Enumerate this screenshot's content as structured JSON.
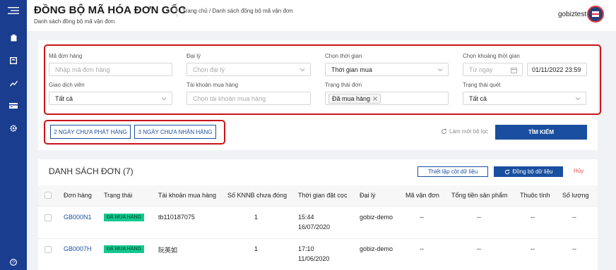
{
  "header": {
    "title": "ĐỒNG BỘ MÃ HÓA ĐƠN GỐC",
    "subtitle": "Danh sách đồng bộ mã vận đơn",
    "breadcrumb_home": "Trang chủ",
    "breadcrumb_sep": " / ",
    "breadcrumb_current": "Danh sách đồng bộ mã vận đơn",
    "username": "gobiztest"
  },
  "sidebar": {
    "icons": [
      "menu-icon",
      "clipboard-icon",
      "box-icon",
      "chart-icon",
      "card-icon",
      "gear-icon",
      "help-icon"
    ]
  },
  "filters": {
    "order_code": {
      "label": "Mã đơn hàng",
      "placeholder": "Nhập mã đơn hàng"
    },
    "agent": {
      "label": "Đại lý",
      "placeholder": "Chọn đại lý"
    },
    "time_type": {
      "label": "Chọn thời gian",
      "value": "Thời gian mua"
    },
    "time_range": {
      "label": "Chọn khoảng thời gian",
      "from_placeholder": "Từ ngày",
      "to_value": "01/11/2022 23:59"
    },
    "trader": {
      "label": "Giao dịch viên",
      "value": "Tất cả"
    },
    "account": {
      "label": "Tài khoản mua hàng",
      "placeholder": "Chọn tài khoản mua hàng"
    },
    "order_status": {
      "label": "Trạng thái đơn",
      "tag": "Đã mua hàng"
    },
    "scan_status": {
      "label": "Trạng thái quét",
      "value": "Tất cả"
    }
  },
  "quick_filters": {
    "not_shipped": "2 NGÀY CHƯA PHÁT HÀNG",
    "not_received": "3 NGÀY CHƯA NHẬN HÀNG"
  },
  "actions": {
    "reset": "Làm mới bộ lọc",
    "search": "TÌM KIẾM"
  },
  "list": {
    "title": "DANH SÁCH ĐƠN (7)",
    "setup_columns": "Thiết lập cột dữ liệu",
    "sync": "Đồng bộ dữ liệu",
    "cancel": "Hủy",
    "columns": [
      "Đơn hàng",
      "Trạng thái",
      "Tài khoản mua hàng",
      "Số KNNB chưa đóng",
      "Thời gian đặt cọc",
      "Đại lý",
      "Mã vận đơn",
      "Tổng tiền sản phẩm",
      "Thuộc tính",
      "Số lượng"
    ],
    "rows": [
      {
        "order": "GB000N1",
        "status": "ĐÃ MUA HÀNG",
        "account": "tb110187075",
        "knnb": "1",
        "time": "15:44",
        "date": "16/07/2020",
        "agent": "gobiz-demo",
        "waybill": "--",
        "total": "--",
        "attr": "--",
        "qty": "--"
      },
      {
        "order": "GB0007H",
        "status": "ĐÃ MUA HÀNG",
        "account": "阮英如",
        "knnb": "1",
        "time": "17:10",
        "date": "11/06/2020",
        "agent": "gobiz-demo",
        "waybill": "--",
        "total": "--",
        "attr": "--",
        "qty": "--"
      }
    ]
  },
  "colors": {
    "sidebar": "#1a3d8f",
    "primary": "#1a4fa0",
    "highlight_border": "#c8151b",
    "status_badge": "#13c98f",
    "cancel": "#d9534f"
  }
}
